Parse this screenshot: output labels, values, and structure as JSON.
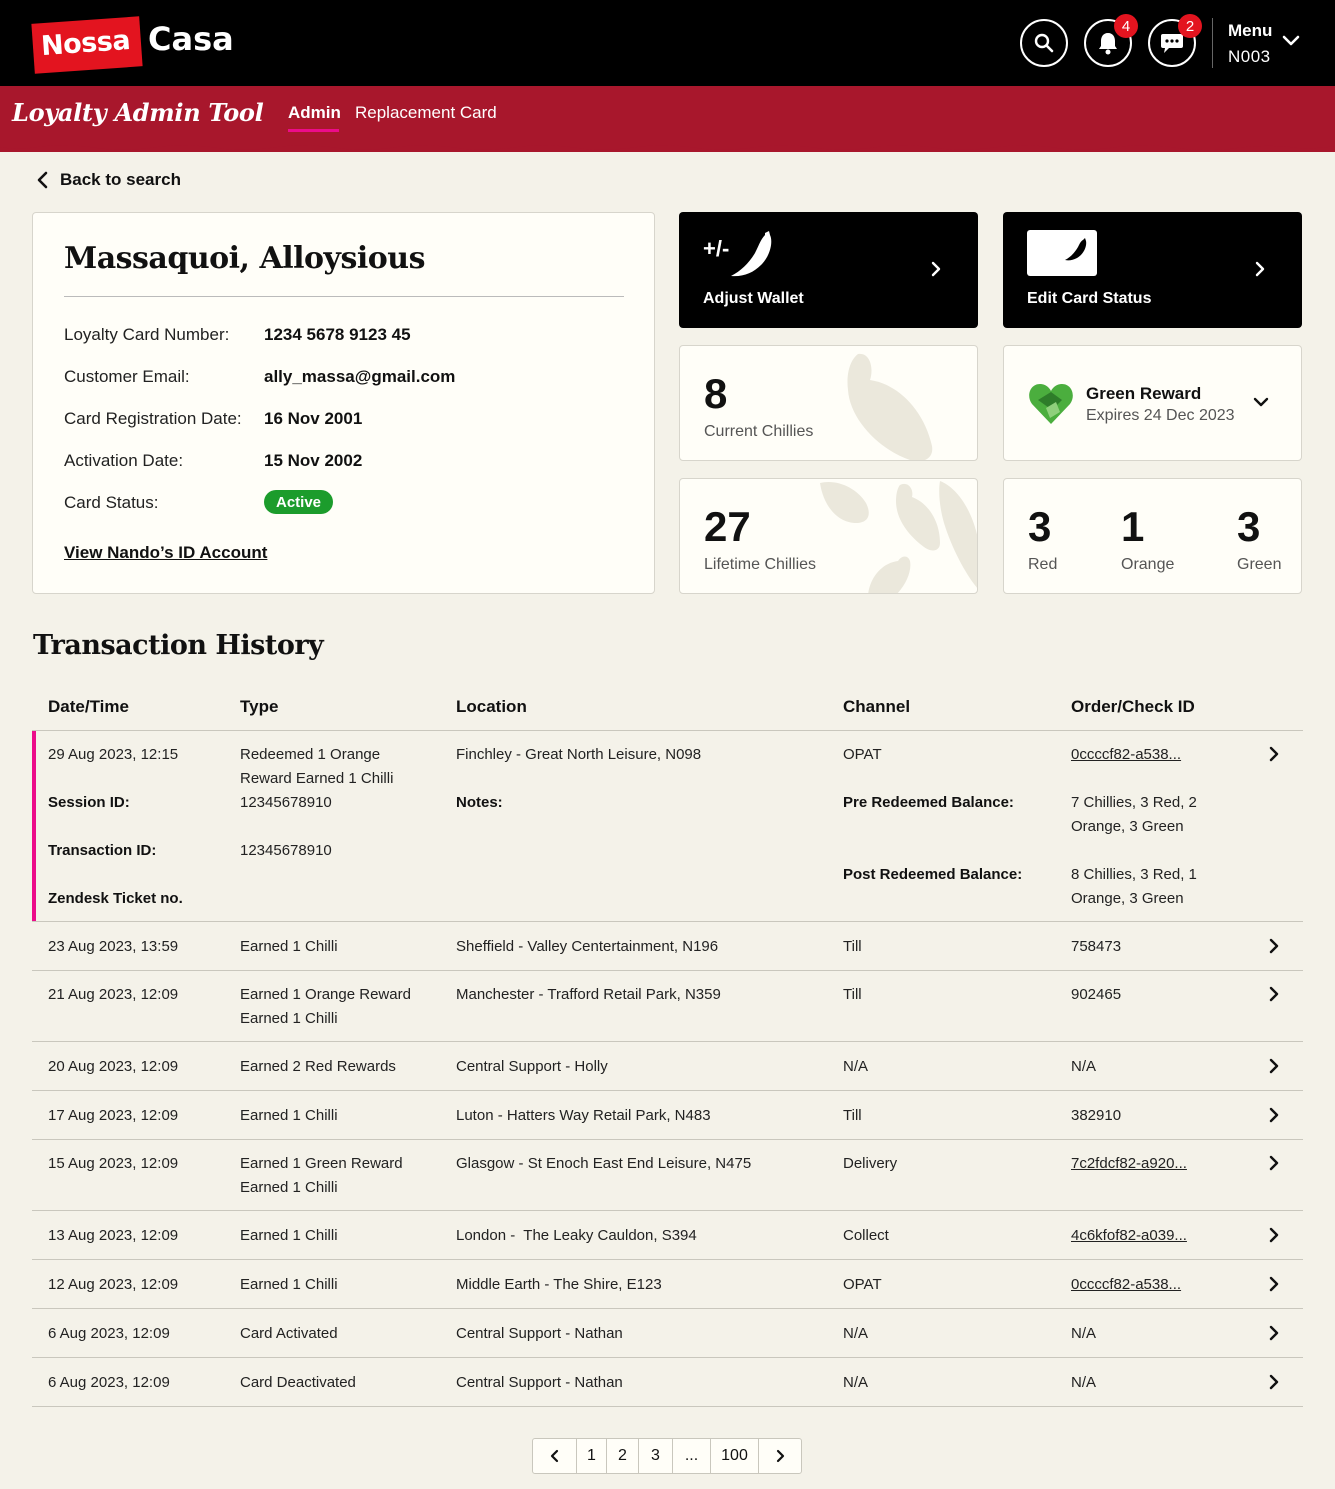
{
  "header": {
    "logo_left": "Nossa",
    "logo_right": "Casa",
    "notifications_count": "4",
    "messages_count": "2",
    "menu_label": "Menu",
    "menu_code": "N003"
  },
  "nav": {
    "tool_title": "Loyalty Admin Tool",
    "tabs": [
      {
        "label": "Admin",
        "active": true
      },
      {
        "label": "Replacement Card",
        "active": false
      }
    ]
  },
  "back_label": "Back to search",
  "customer": {
    "name": "Massaquoi, Alloysious",
    "fields": [
      {
        "label": "Loyalty Card Number:",
        "value": "1234 5678 9123 45"
      },
      {
        "label": "Customer Email:",
        "value": "ally_massa@gmail.com"
      },
      {
        "label": "Card Registration Date:",
        "value": "16 Nov 2001"
      },
      {
        "label": "Activation Date:",
        "value": "15 Nov 2002"
      }
    ],
    "status_label": "Card Status:",
    "status_value": "Active",
    "id_link": "View Nando’s ID Account"
  },
  "actions": {
    "adjust_wallet": {
      "symbol": "+/-",
      "label": "Adjust Wallet"
    },
    "edit_card_status": {
      "label": "Edit Card Status"
    }
  },
  "stats": {
    "current_chillies": {
      "value": "8",
      "label": "Current Chillies"
    },
    "lifetime_chillies": {
      "value": "27",
      "label": "Lifetime Chillies"
    },
    "reward": {
      "title": "Green Reward",
      "expires": "Expires 24 Dec 2023"
    },
    "rewards_counts": [
      {
        "value": "3",
        "label": "Red"
      },
      {
        "value": "1",
        "label": "Orange"
      },
      {
        "value": "3",
        "label": "Green"
      }
    ]
  },
  "transactions": {
    "title": "Transaction History",
    "columns": [
      "Date/Time",
      "Type",
      "Location",
      "Channel",
      "Order/Check ID"
    ],
    "expanded": {
      "datetime": "29 Aug 2023, 12:15",
      "type_lines": [
        "Redeemed 1 Orange",
        "Reward Earned 1 Chilli"
      ],
      "location": "Finchley - Great North Leisure, N098",
      "channel": "OPAT",
      "order_id": "0ccccf82-a538...",
      "session_label": "Session ID:",
      "session_value": "12345678910",
      "notes_label": "Notes:",
      "pre_label": "Pre Redeemed Balance:",
      "pre_lines": [
        "7 Chillies, 3 Red, 2",
        "Orange, 3 Green"
      ],
      "txn_label": "Transaction ID:",
      "txn_value": "12345678910",
      "post_label": "Post Redeemed Balance:",
      "post_lines": [
        "8 Chillies, 3 Red, 1",
        "Orange, 3 Green"
      ],
      "zendesk_label": "Zendesk Ticket no."
    },
    "rows": [
      {
        "datetime": "23 Aug 2023, 13:59",
        "type_lines": [
          "Earned 1 Chilli"
        ],
        "location": "Sheffield - Valley Centertainment, N196",
        "channel": "Till",
        "order_id": "758473",
        "link": false
      },
      {
        "datetime": "21 Aug 2023, 12:09",
        "type_lines": [
          "Earned 1 Orange Reward",
          "Earned 1 Chilli"
        ],
        "location": "Manchester - Trafford Retail Park, N359",
        "channel": "Till",
        "order_id": "902465",
        "link": false
      },
      {
        "datetime": "20 Aug 2023, 12:09",
        "type_lines": [
          "Earned 2 Red Rewards"
        ],
        "location": "Central Support - Holly",
        "channel": "N/A",
        "order_id": "N/A",
        "link": false
      },
      {
        "datetime": "17 Aug 2023, 12:09",
        "type_lines": [
          "Earned 1 Chilli"
        ],
        "location": "Luton - Hatters Way Retail Park, N483",
        "channel": "Till",
        "order_id": "382910",
        "link": false
      },
      {
        "datetime": "15 Aug 2023, 12:09",
        "type_lines": [
          "Earned 1 Green Reward",
          "Earned 1 Chilli"
        ],
        "location": "Glasgow - St Enoch East End Leisure, N475",
        "channel": "Delivery",
        "order_id": "7c2fdcf82-a920...",
        "link": true
      },
      {
        "datetime": "13 Aug 2023, 12:09",
        "type_lines": [
          "Earned 1 Chilli"
        ],
        "location": "London -  The Leaky Cauldon, S394",
        "channel": "Collect",
        "order_id": "4c6kfof82-a039...",
        "link": true
      },
      {
        "datetime": "12 Aug 2023, 12:09",
        "type_lines": [
          "Earned 1 Chilli"
        ],
        "location": "Middle Earth - The Shire, E123",
        "channel": "OPAT",
        "order_id": "0ccccf82-a538...",
        "link": true
      },
      {
        "datetime": "6 Aug 2023, 12:09",
        "type_lines": [
          "Card Activated"
        ],
        "location": "Central Support - Nathan",
        "channel": "N/A",
        "order_id": "N/A",
        "link": false
      },
      {
        "datetime": "6 Aug 2023, 12:09",
        "type_lines": [
          "Card Deactivated"
        ],
        "location": "Central Support - Nathan",
        "channel": "N/A",
        "order_id": "N/A",
        "link": false
      }
    ]
  },
  "pagination": {
    "pages": [
      "1",
      "2",
      "3",
      "...",
      "100"
    ]
  },
  "colors": {
    "brand_red": "#a8172c",
    "logo_red": "#e3141f",
    "accent_pink": "#ec0c8a",
    "active_green": "#1c9c2c"
  }
}
